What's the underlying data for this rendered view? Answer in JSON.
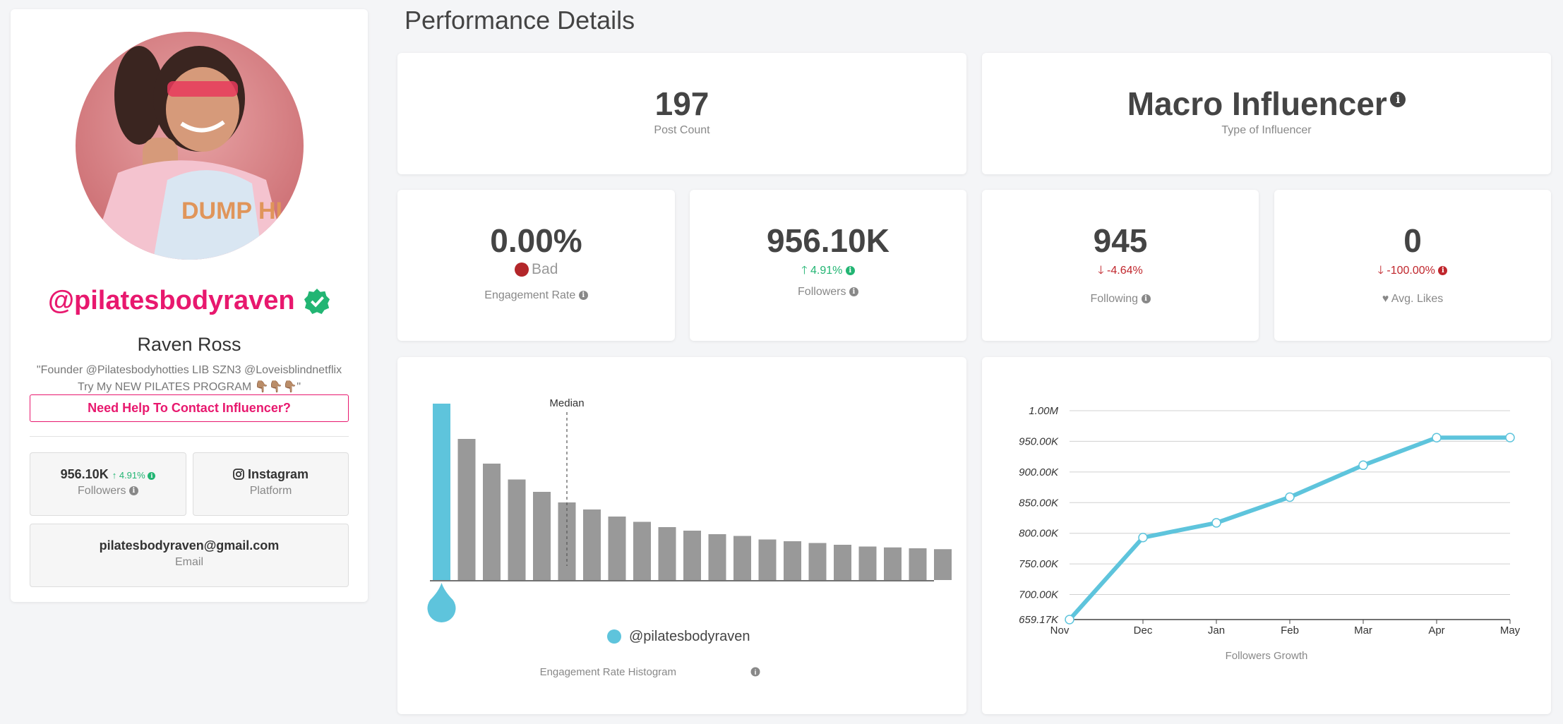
{
  "profile": {
    "handle": "@pilatesbodyraven",
    "name": "Raven Ross",
    "bio_line1": "\"Founder @Pilatesbodyhotties LIB SZN3 @Loveisblindnetflix",
    "bio_line2": "Try My NEW PILATES PROGRAM 👇🏽👇🏽👇🏽\"",
    "avatar_shirt_text": "DUMP HI",
    "contact_button": "Need Help To Contact Influencer?",
    "followers_value": "956.10K",
    "followers_growth": "4.91%",
    "followers_label": "Followers",
    "platform_value": "Instagram",
    "platform_label": "Platform",
    "email_value": "pilatesbodyraven@gmail.com",
    "email_label": "Email",
    "icons": [
      "verified-badge-icon",
      "instagram-icon",
      "info-icon",
      "arrow-up-icon"
    ]
  },
  "page_title": "Performance Details",
  "cards": {
    "post_count": {
      "value": "197",
      "label": "Post Count"
    },
    "influencer_type": {
      "value": "Macro Influencer",
      "label": "Type of Influencer"
    },
    "engagement": {
      "value": "0.00%",
      "rating": "Bad",
      "label": "Engagement Rate"
    },
    "followers": {
      "value": "956.10K",
      "change": "4.91%",
      "label": "Followers"
    },
    "following": {
      "value": "945",
      "change": "-4.64%",
      "label": "Following"
    },
    "likes": {
      "value": "0",
      "change": "-100.00%",
      "label": "Avg. Likes"
    }
  },
  "colors": {
    "accent": "#e8186e",
    "teal": "#5ec4dc",
    "green": "#22b573",
    "red": "#c0262c",
    "bar_gray": "#999999"
  },
  "histogram": {
    "median_label": "Median",
    "legend": "@pilatesbodyraven",
    "caption": "Engagement Rate Histogram"
  },
  "chart_data": [
    {
      "type": "bar",
      "title": "Engagement Rate Histogram",
      "values": [
        100,
        80,
        66,
        57,
        50,
        44,
        40,
        36,
        33,
        30,
        28,
        26,
        25,
        23,
        22,
        21,
        20,
        19,
        18.5,
        18,
        17.5
      ],
      "highlight_index": 0,
      "median_index": 5,
      "series": [
        {
          "name": "@pilatesbodyraven"
        }
      ]
    },
    {
      "type": "line",
      "title": "Followers Growth",
      "categories": [
        "Nov",
        "Dec",
        "Jan",
        "Feb",
        "Mar",
        "Apr",
        "May"
      ],
      "values": [
        659170,
        793000,
        817000,
        859000,
        911000,
        956000,
        956100
      ],
      "y_ticks": [
        "659.17K",
        "700.00K",
        "750.00K",
        "800.00K",
        "850.00K",
        "900.00K",
        "950.00K",
        "1.00M"
      ],
      "y_tick_values": [
        659170,
        700000,
        750000,
        800000,
        850000,
        900000,
        950000,
        1000000
      ],
      "ylim": [
        659170,
        1000000
      ],
      "grid": true
    }
  ]
}
